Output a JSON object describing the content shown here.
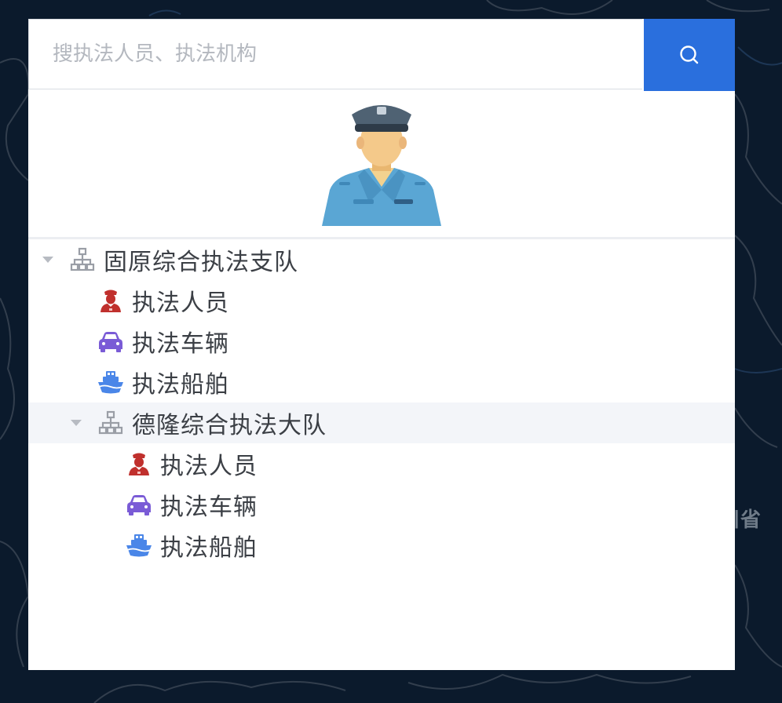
{
  "search": {
    "placeholder": "搜执法人员、执法机构",
    "button_icon": "search-icon"
  },
  "avatar": {
    "icon": "police-officer-avatar"
  },
  "tree": {
    "root": {
      "label": "固原综合执法支队",
      "icon": "org-hierarchy-icon",
      "expanded": true,
      "children": [
        {
          "label": "执法人员",
          "icon": "officer-icon"
        },
        {
          "label": "执法车辆",
          "icon": "car-icon"
        },
        {
          "label": "执法船舶",
          "icon": "ship-icon"
        }
      ]
    },
    "sub": {
      "label": "德隆综合执法大队",
      "icon": "org-hierarchy-icon",
      "expanded": true,
      "selected": true,
      "children": [
        {
          "label": "执法人员",
          "icon": "officer-icon"
        },
        {
          "label": "执法车辆",
          "icon": "car-icon"
        },
        {
          "label": "执法船舶",
          "icon": "ship-icon"
        }
      ]
    }
  },
  "map": {
    "partial_label": "川省"
  },
  "colors": {
    "accent": "#2a6fdd",
    "officer": "#c0302d",
    "car": "#7a5bd6",
    "ship": "#4a86e8",
    "map_background": "#0b1a2c"
  }
}
